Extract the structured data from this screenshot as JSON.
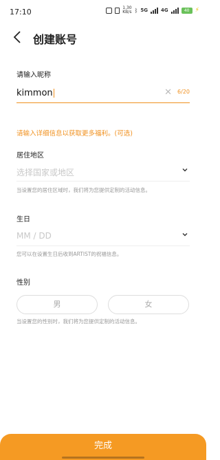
{
  "status_bar": {
    "time": "17:10",
    "speed": "1.30\nKB/s",
    "network": "5G",
    "network2": "4G",
    "battery": "40"
  },
  "header": {
    "title": "创建账号"
  },
  "nickname": {
    "label": "请输入昵称",
    "value": "kimmon",
    "counter": "6/20"
  },
  "promo_text": "请输入详细信息以获取更多福利。(可选)",
  "region": {
    "label": "居住地区",
    "placeholder": "选择国家或地区",
    "hint": "当设置您的居住区域时，我们将为您提供定制的活动信息。"
  },
  "birthday": {
    "label": "生日",
    "placeholder": "MM / DD",
    "hint": "您可以在设置生日后收到ARTIST的祝福信息。"
  },
  "gender": {
    "label": "性别",
    "male": "男",
    "female": "女",
    "hint": "当设置您的性别时，我们将为您提供定制的活动信息。"
  },
  "done_button": "完成",
  "colors": {
    "accent": "#f0901e",
    "done_bg": "#f59a23"
  }
}
